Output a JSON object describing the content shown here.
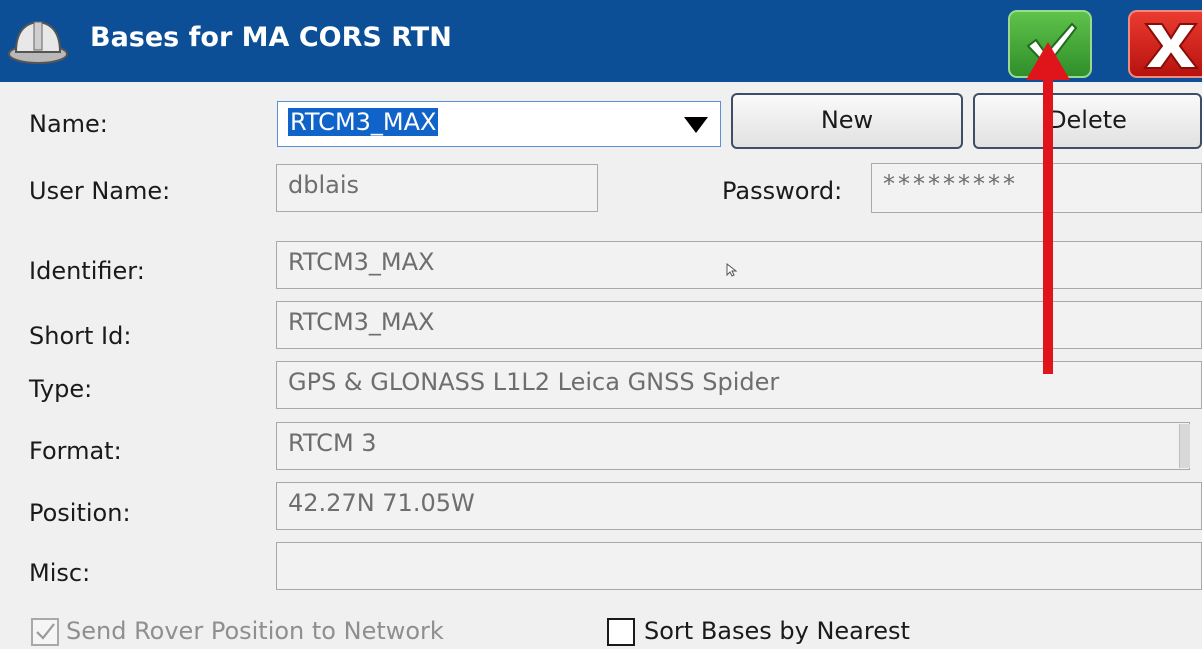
{
  "window": {
    "title": "Bases for MA CORS RTN",
    "ok_icon": "checkmark-icon",
    "cancel_icon": "close-x-icon"
  },
  "colors": {
    "titlebar": "#0d4f97",
    "ok": "#3aa632",
    "cancel": "#d8231a",
    "selection": "#0f63c9",
    "annotation": "#e0141b"
  },
  "labels": {
    "name": "Name:",
    "user_name": "User Name:",
    "password": "Password:",
    "identifier": "Identifier:",
    "short_id": "Short Id:",
    "type": "Type:",
    "format": "Format:",
    "position": "Position:",
    "misc": "Misc:"
  },
  "fields": {
    "name": "RTCM3_MAX",
    "user_name": "dblais",
    "password": "*********",
    "identifier": "RTCM3_MAX",
    "short_id": "RTCM3_MAX",
    "type": "GPS & GLONASS L1L2 Leica GNSS Spider",
    "format": "RTCM 3",
    "position": "42.27N 71.05W",
    "misc": ""
  },
  "buttons": {
    "new": "New",
    "delete": "Delete"
  },
  "checkboxes": {
    "send_rover": {
      "label": "Send Rover Position to Network",
      "checked": true,
      "enabled": false
    },
    "sort_bases": {
      "label": "Sort Bases by Nearest",
      "checked": false,
      "enabled": true
    }
  }
}
